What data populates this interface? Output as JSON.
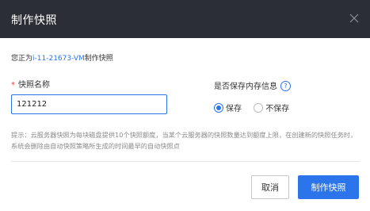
{
  "dialog": {
    "title": "制作快照",
    "close_icon": "close-icon"
  },
  "desc": {
    "prefix": "您正为",
    "vm_name": "i-11-21673-VM",
    "suffix": "制作快照"
  },
  "form": {
    "name_label": "快照名称",
    "required_mark": "*",
    "name_value": "121212",
    "memory_label": "是否保存内存信息",
    "help_icon": "question-circle-icon",
    "help_glyph": "?",
    "options": [
      {
        "label": "保存",
        "selected": true
      },
      {
        "label": "不保存",
        "selected": false
      }
    ]
  },
  "tip": "提示：云服务器快照为每块磁盘提供10个快照额度，当某个云服务器的快照数量达到额度上限，在创建新的快照任务时，系统会删除由自动快照策略所生成的时间最早的自动快照点",
  "buttons": {
    "cancel": "取消",
    "confirm": "制作快照"
  },
  "colors": {
    "header_bg": "#2b2e34",
    "accent": "#2b74ea",
    "required": "#e23c39"
  }
}
